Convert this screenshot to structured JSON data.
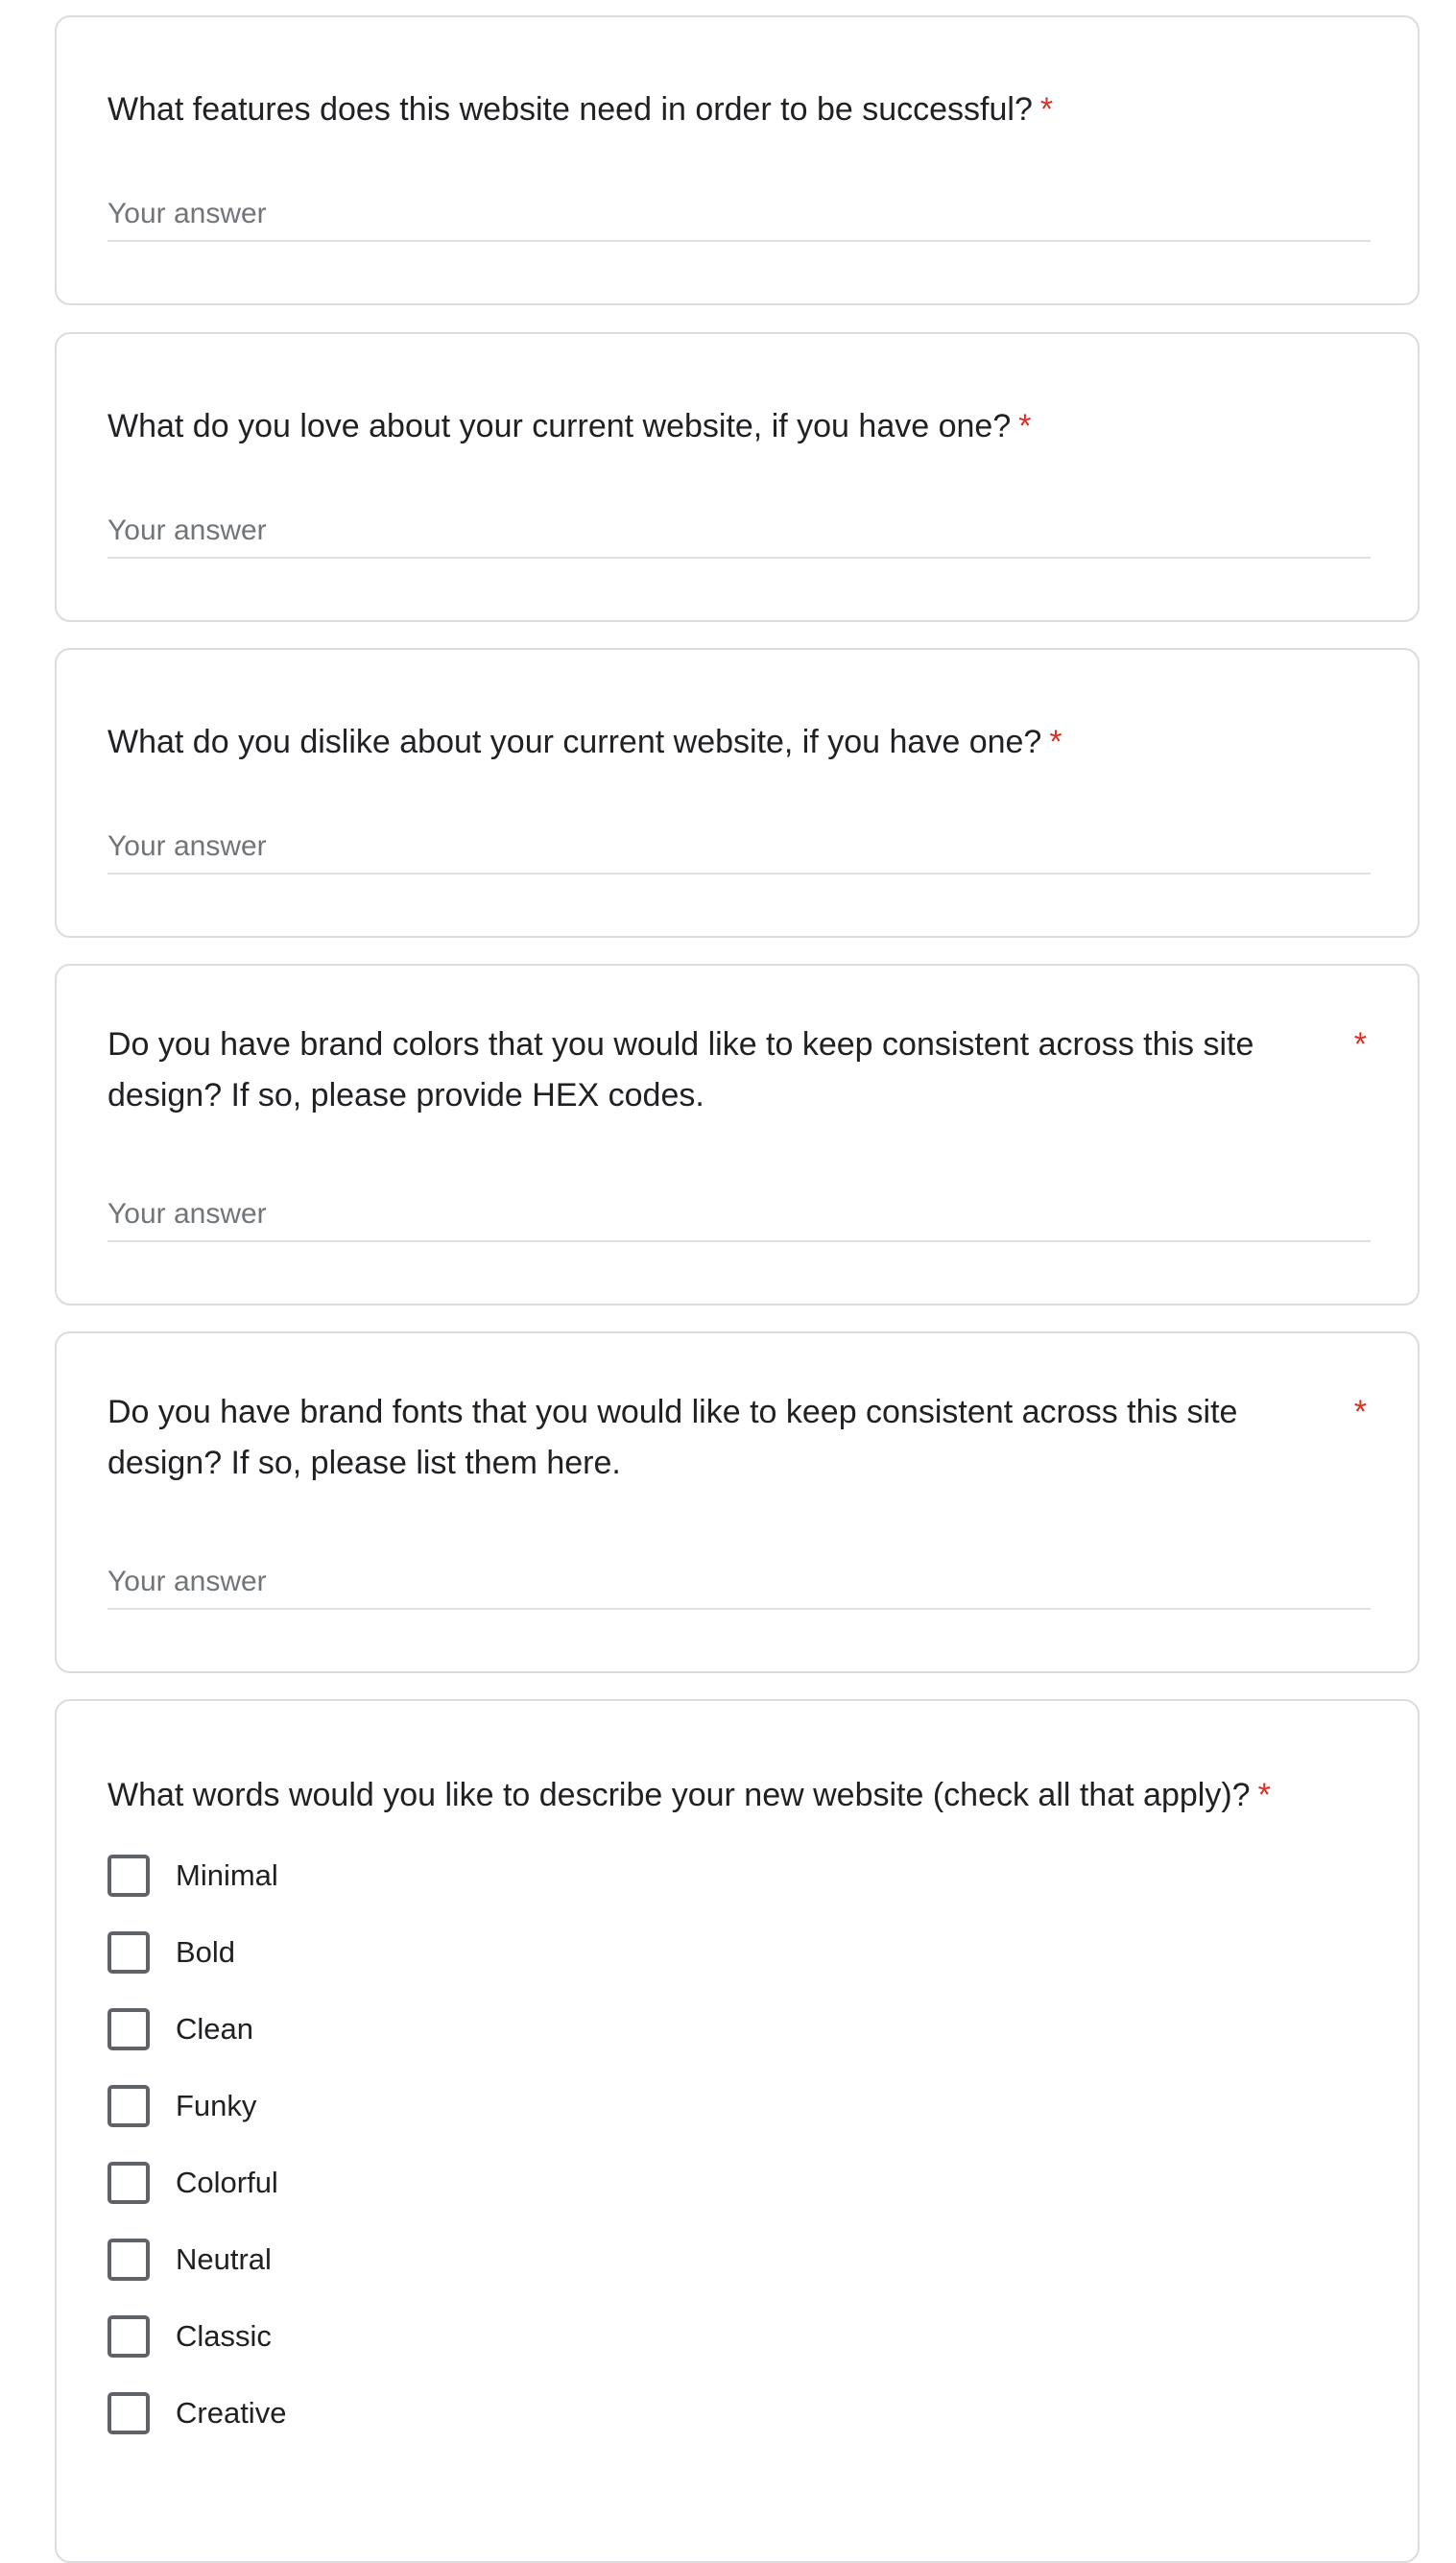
{
  "required_marker": "*",
  "questions": [
    {
      "text": "What features does this website need in order to be successful?",
      "placeholder": "Your answer"
    },
    {
      "text": "What do you love about your current website, if you have one?",
      "placeholder": "Your answer"
    },
    {
      "text": "What do you dislike about your current website, if you have one?",
      "placeholder": "Your answer"
    },
    {
      "text": "Do you have brand colors that you would like to keep consistent across this site design? If so, please provide HEX codes.",
      "placeholder": "Your answer"
    },
    {
      "text": "Do you have brand fonts that you would like to keep consistent across this site design? If so, please list them here.",
      "placeholder": "Your answer"
    },
    {
      "text": "What words would you like to describe your new website (check all that apply)?",
      "options": [
        {
          "label": "Minimal",
          "checked": false
        },
        {
          "label": "Bold",
          "checked": false
        },
        {
          "label": "Clean",
          "checked": false
        },
        {
          "label": "Funky",
          "checked": false
        },
        {
          "label": "Colorful",
          "checked": false
        },
        {
          "label": "Neutral",
          "checked": false
        },
        {
          "label": "Classic",
          "checked": false
        },
        {
          "label": "Creative",
          "checked": false
        }
      ]
    }
  ],
  "colors": {
    "required": "#d93025",
    "card_border": "#dadce0",
    "placeholder": "#70757a",
    "checkbox_border": "#5f6368"
  }
}
